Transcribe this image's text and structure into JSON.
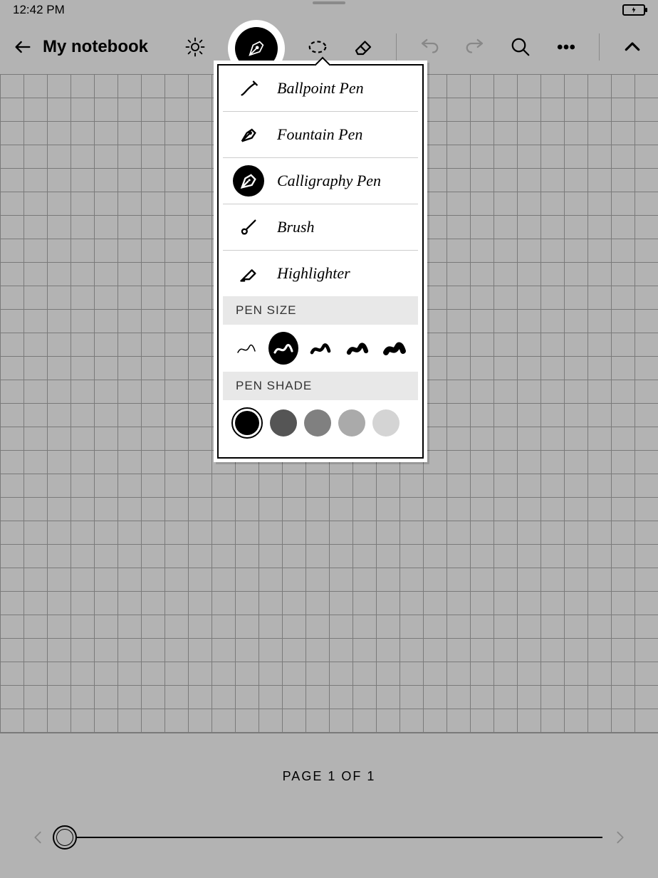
{
  "status": {
    "time": "12:42 PM"
  },
  "header": {
    "title": "My notebook"
  },
  "popover": {
    "pens": [
      {
        "id": "ballpoint",
        "label": "Ballpoint Pen",
        "selected": false
      },
      {
        "id": "fountain",
        "label": "Fountain Pen",
        "selected": false
      },
      {
        "id": "calligraphy",
        "label": "Calligraphy Pen",
        "selected": true
      },
      {
        "id": "brush",
        "label": "Brush",
        "selected": false
      },
      {
        "id": "highlighter",
        "label": "Highlighter",
        "selected": false
      }
    ],
    "size_label": "PEN SIZE",
    "sizes": [
      {
        "weight": 1,
        "selected": false
      },
      {
        "weight": 2,
        "selected": true
      },
      {
        "weight": 3,
        "selected": false
      },
      {
        "weight": 4,
        "selected": false
      },
      {
        "weight": 5,
        "selected": false
      }
    ],
    "shade_label": "PEN SHADE",
    "shades": [
      {
        "hex": "#000000",
        "selected": true
      },
      {
        "hex": "#555555",
        "selected": false
      },
      {
        "hex": "#808080",
        "selected": false
      },
      {
        "hex": "#aaaaaa",
        "selected": false
      },
      {
        "hex": "#d4d4d4",
        "selected": false
      }
    ]
  },
  "footer": {
    "page_label": "PAGE 1 OF 1"
  }
}
